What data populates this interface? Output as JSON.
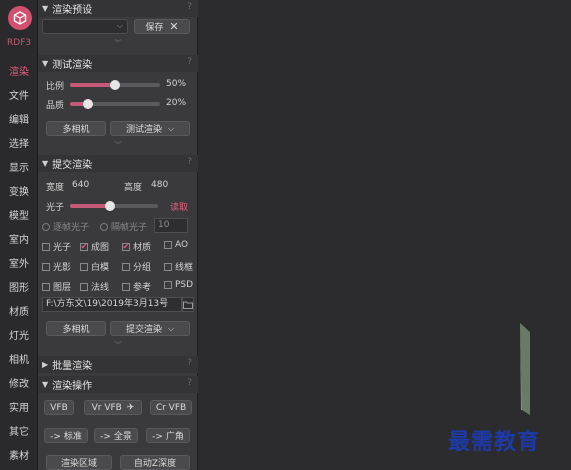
{
  "nav": {
    "logo_label": "RDF3",
    "items": [
      "渲染",
      "文件",
      "编辑",
      "选择",
      "显示",
      "变换",
      "模型",
      "室内",
      "室外",
      "图形",
      "材质",
      "灯光",
      "相机",
      "修改",
      "实用",
      "其它",
      "素材"
    ]
  },
  "preset": {
    "title": "渲染预设",
    "help": "?",
    "save_label": "保存",
    "close": "✕",
    "collapse": "︾"
  },
  "test": {
    "title": "测试渲染",
    "help": "?",
    "ratio_label": "比例",
    "ratio_value": "50%",
    "ratio_fraction": 0.5,
    "quality_label": "品质",
    "quality_value": "20%",
    "quality_fraction": 0.2,
    "multi_camera": "多相机",
    "test_render": "测试渲染",
    "caret": "⌵",
    "collapse": "︾"
  },
  "submit": {
    "title": "提交渲染",
    "help": "?",
    "width_label": "宽度",
    "width_value": "640",
    "height_label": "高度",
    "height_value": "480",
    "photon_label": "光子",
    "photon_fraction": 0.45,
    "read_label": "读取",
    "frame_photon": "逐帧光子",
    "interval_photon": "隔帧光子",
    "interval_value": "10",
    "checks": [
      {
        "label": "光子",
        "checked": false
      },
      {
        "label": "成图",
        "checked": true
      },
      {
        "label": "材质",
        "checked": true
      },
      {
        "label": "AO",
        "checked": false
      },
      {
        "label": "光影",
        "checked": false
      },
      {
        "label": "白模",
        "checked": false
      },
      {
        "label": "分组",
        "checked": false
      },
      {
        "label": "线框",
        "checked": false
      },
      {
        "label": "图层",
        "checked": false
      },
      {
        "label": "法线",
        "checked": false
      },
      {
        "label": "参考",
        "checked": false
      },
      {
        "label": "PSD",
        "checked": false
      }
    ],
    "path": "F:\\方东文\\19\\2019年3月13号",
    "multi_camera": "多相机",
    "submit_render": "提交渲染",
    "caret": "⌵",
    "collapse": "︾"
  },
  "batch": {
    "title": "批量渲染",
    "help": "?"
  },
  "ops": {
    "title": "渲染操作",
    "help": "?",
    "vfb": "VFB",
    "vr_vfb": "Vr VFB",
    "cr_vfb": "Cr VFB",
    "standard": "-> 标准",
    "panorama": "-> 全景",
    "wide": "-> 广角",
    "region": "渲染区域",
    "auto_z": "自动Z深度"
  },
  "watermark": "最需教育"
}
